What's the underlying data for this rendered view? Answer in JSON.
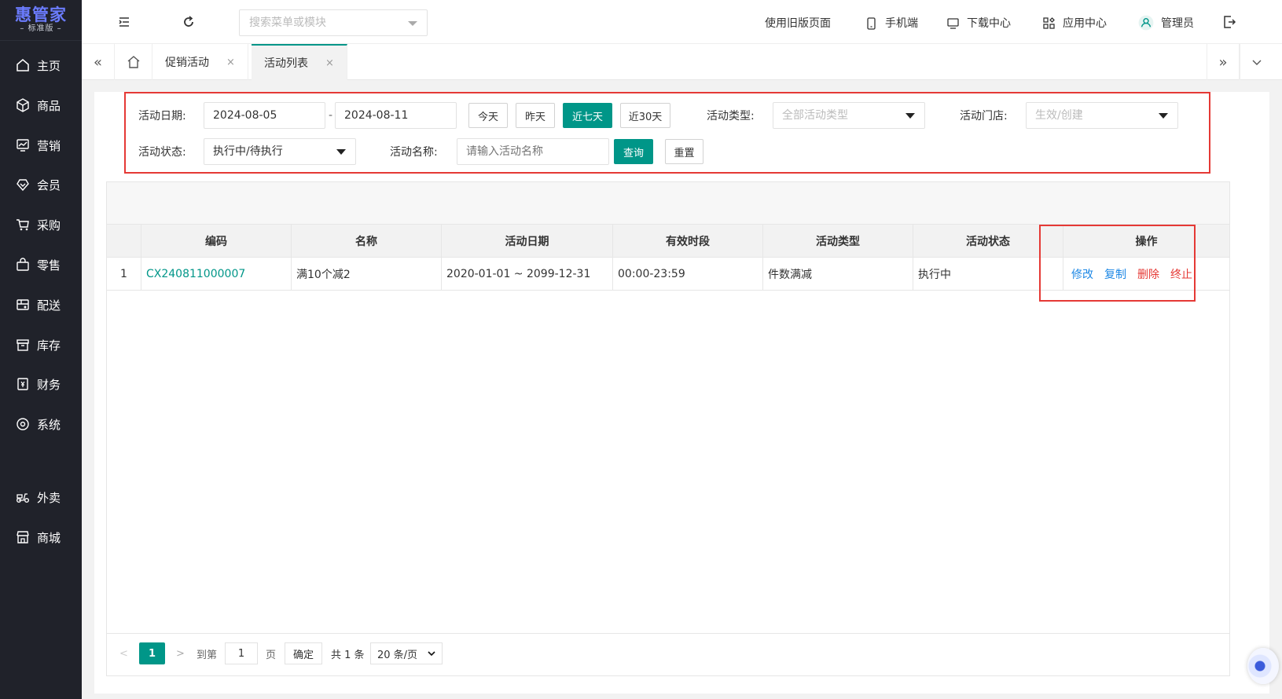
{
  "logo": {
    "main": "惠管家",
    "sub": "– 标准版 –"
  },
  "sidebar": {
    "items": [
      {
        "label": "主页",
        "icon": "home-icon"
      },
      {
        "label": "商品",
        "icon": "box-icon"
      },
      {
        "label": "营销",
        "icon": "chart-monitor-icon"
      },
      {
        "label": "会员",
        "icon": "diamond-icon"
      },
      {
        "label": "采购",
        "icon": "cart-icon"
      },
      {
        "label": "零售",
        "icon": "bag-icon"
      },
      {
        "label": "配送",
        "icon": "delivery-icon"
      },
      {
        "label": "库存",
        "icon": "inventory-icon"
      },
      {
        "label": "财务",
        "icon": "finance-icon"
      },
      {
        "label": "系统",
        "icon": "settings-icon"
      },
      {
        "label": "外卖",
        "icon": "scooter-icon"
      },
      {
        "label": "商城",
        "icon": "store-icon"
      }
    ]
  },
  "topbar": {
    "search_placeholder": "搜索菜单或模块",
    "old_version": "使用旧版页面",
    "mobile": "手机端",
    "download": "下载中心",
    "apps": "应用中心",
    "user": "管理员"
  },
  "tabs": [
    {
      "label": "促销活动",
      "close": "×"
    },
    {
      "label": "活动列表",
      "close": "×"
    }
  ],
  "filter": {
    "date_label": "活动日期:",
    "date_start": "2024-08-05",
    "date_sep": "-",
    "date_end": "2024-08-11",
    "btn_today": "今天",
    "btn_yesterday": "昨天",
    "btn_7days": "近七天",
    "btn_30days": "近30天",
    "type_label": "活动类型:",
    "type_value": "全部活动类型",
    "store_label": "活动门店:",
    "store_value": "生效/创建",
    "status_label": "活动状态:",
    "status_value": "执行中/待执行",
    "name_label": "活动名称:",
    "name_placeholder": "请输入活动名称",
    "btn_query": "查询",
    "btn_reset": "重置"
  },
  "table": {
    "headers": {
      "code": "编码",
      "name": "名称",
      "date": "活动日期",
      "time": "有效时段",
      "type": "活动类型",
      "status": "活动状态",
      "op": "操作"
    },
    "rows": [
      {
        "idx": "1",
        "code": "CX240811000007",
        "name": "满10个减2",
        "date": "2020-01-01 ~ 2099-12-31",
        "time": "00:00-23:59",
        "type": "件数满减",
        "status": "执行中"
      }
    ],
    "ops": {
      "edit": "修改",
      "copy": "复制",
      "delete": "删除",
      "stop": "终止"
    }
  },
  "pager": {
    "prev": "<",
    "current": "1",
    "next": ">",
    "goto_label": "到第",
    "goto_value": "1",
    "page_unit": "页",
    "confirm": "确定",
    "total": "共 1 条",
    "per_page": "20 条/页"
  },
  "colors": {
    "accent": "#009688",
    "sidebar_bg": "#20222a",
    "highlight_border": "#e53935",
    "link_blue": "#1e88e5"
  }
}
